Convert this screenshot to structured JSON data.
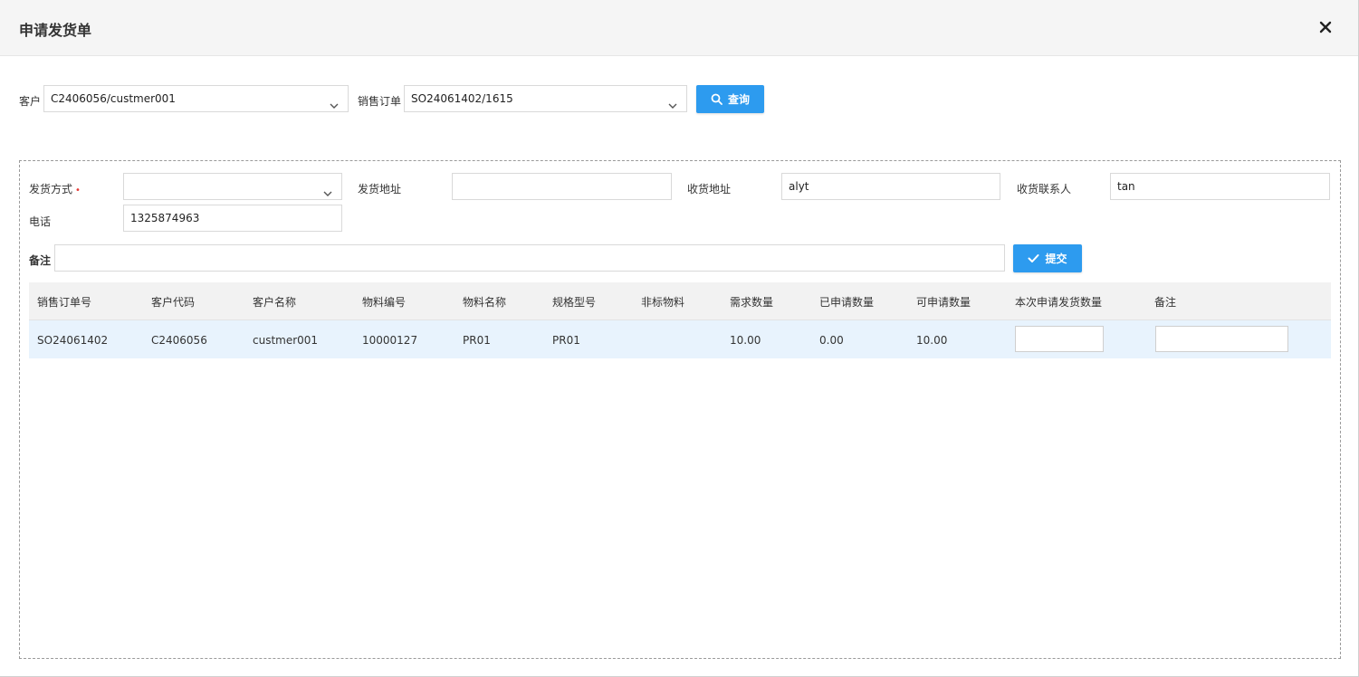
{
  "dialog": {
    "title": "申请发货单",
    "close_icon": "close-icon"
  },
  "filter": {
    "customer_label": "客户",
    "customer_value": "C2406056/custmer001",
    "order_label": "销售订单",
    "order_value": "SO24061402/1615",
    "query_label": "查询"
  },
  "form": {
    "ship_method_label": "发货方式",
    "ship_method_required": "•",
    "ship_method_value": "",
    "ship_address_label": "发货地址",
    "ship_address_value": "",
    "receive_address_label": "收货地址",
    "receive_address_value": "alyt",
    "contact_label": "收货联系人",
    "contact_value": "tan",
    "phone_label": "电话",
    "phone_value": "1325874963",
    "remark_label": "备注",
    "remark_value": "",
    "submit_label": "提交"
  },
  "table": {
    "columns": [
      "销售订单号",
      "客户代码",
      "客户名称",
      "物料编号",
      "物料名称",
      "规格型号",
      "非标物料",
      "需求数量",
      "已申请数量",
      "可申请数量",
      "本次申请发货数量",
      "备注"
    ],
    "rows": [
      {
        "order_no": "SO24061402",
        "customer_code": "C2406056",
        "customer_name": "custmer001",
        "material_no": "10000127",
        "material_name": "PR01",
        "spec": "PR01",
        "nonstandard": "",
        "demand_qty": "10.00",
        "applied_qty": "0.00",
        "available_qty": "10.00",
        "this_qty": "",
        "remark": ""
      }
    ]
  },
  "colors": {
    "accent": "#2d9bef",
    "header_bg": "#f5f5f5",
    "row_highlight": "#e8f3fd",
    "required": "#e53935"
  }
}
